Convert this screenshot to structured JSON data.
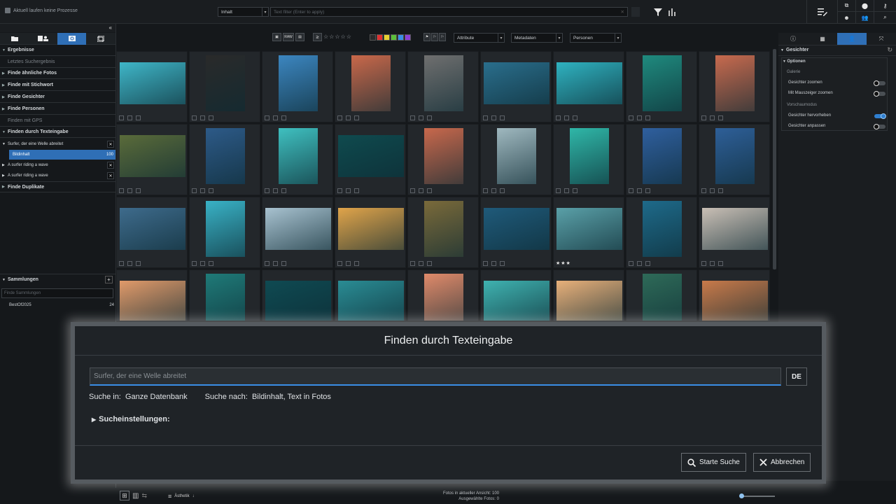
{
  "topbar": {
    "process_status": "Aktuell laufen keine Prozesse",
    "filter_scope": "Inhalt",
    "text_filter_placeholder": "Text filter (Enter to apply)",
    "right_icons": [
      "edit-list-icon",
      "copy-icon",
      "map-pin-icon",
      "key-icon",
      "face-icon",
      "people-icon",
      "search-icon"
    ]
  },
  "left_panel": {
    "tabs": [
      "folder-icon",
      "calendar-people-icon",
      "search-icon",
      "album-icon"
    ],
    "active_tab": 2,
    "sections": [
      {
        "label": "Ergebnisse",
        "dim": false
      },
      {
        "label": "Letztes Suchergebnis",
        "dim": true
      },
      {
        "label": "Finde ähnliche Fotos",
        "dim": false
      },
      {
        "label": "Finde mit Stichwort",
        "dim": false
      },
      {
        "label": "Finde Gesichter",
        "dim": false
      },
      {
        "label": "Finde Personen",
        "dim": false
      },
      {
        "label": "Finden mit GPS",
        "dim": true
      },
      {
        "label": "Finden durch Texteingabe",
        "dim": false
      }
    ],
    "text_searches": [
      {
        "label": "Surfer, der eine Welle abreitet"
      },
      {
        "label": "A surfer riding a wave"
      },
      {
        "label": "A surfer riding a wave"
      }
    ],
    "selected_sub": {
      "label": "Bildinhalt",
      "count": "100"
    },
    "duplicates": "Finde Duplikate",
    "collections": {
      "title": "Sammlungen",
      "search_placeholder": "Finde Sammlungen",
      "items": [
        {
          "name": "BestOf2025",
          "count": "24"
        }
      ]
    }
  },
  "toolbar": {
    "format_buttons": [
      "image-icon",
      "RAW",
      "film-icon"
    ],
    "ge_symbol": "≥",
    "color_swatches": [
      "#2b2b2b",
      "#e03030",
      "#e8d130",
      "#5cbf3a",
      "#3a8ee6",
      "#8a3fd6"
    ],
    "dropdowns": [
      "Attribute",
      "Metadaten",
      "Personen"
    ]
  },
  "grid": {
    "rows": [
      [
        "#3fb6c8",
        "#2a2a2a",
        "#3c86c0",
        "#c9684a",
        "#6f6f6f",
        "#2a6e8c",
        "#2fb2c0",
        "#1f8a7e",
        "#c86a4e"
      ],
      [
        "#5a6b3a",
        "#2d5a88",
        "#3fc0c0",
        "#0f4a4e",
        "#c8684c",
        "#9fb8bf",
        "#2fb7a8",
        "#2f5f9e",
        "#2e5f98"
      ],
      [
        "#3e6b8c",
        "#39b2c6",
        "#a8c2d0",
        "#e0a44a",
        "#7a6a3a",
        "#1f5a7a",
        "#5aa0a8",
        "#1e6a8a",
        "#c9bfb5"
      ],
      [
        "#e09a6a",
        "#1f7a78",
        "#0f4a52",
        "#2a8c94",
        "#e08a6a",
        "#3fb2b0",
        "#e8b07a",
        "#2e6a58",
        "#c87a4a"
      ]
    ],
    "starred": {
      "row": 2,
      "col": 6,
      "stars": "★★★"
    }
  },
  "right_panel": {
    "tabs": [
      "info-icon",
      "table-icon",
      "person-icon",
      "expand-icon"
    ],
    "active_tab": 2,
    "section": "Gesichter",
    "options_label": "Optionen",
    "galerie_label": "Galerie",
    "galerie_options": [
      {
        "label": "Gesichter zoomen",
        "on": false
      },
      {
        "label": "Mit Mauszeiger zoomen",
        "on": false
      }
    ],
    "preview_label": "Vorschaumodus",
    "preview_options": [
      {
        "label": "Gesichter hervorheben",
        "on": true
      },
      {
        "label": "Gesichter anpassen",
        "on": false
      }
    ]
  },
  "bottombar": {
    "sort_label": "Ästhetik",
    "photos_in_view_label": "Fotos in aktueller Ansicht:",
    "photos_in_view": "100",
    "selected_label": "Ausgewählte Fotos:",
    "selected": "0"
  },
  "dialog": {
    "title": "Finden durch Texteingabe",
    "query": "Surfer, der eine Welle abreitet",
    "lang": "DE",
    "search_in_label": "Suche in:",
    "search_in_value": "Ganze Datenbank",
    "search_for_label": "Suche nach:",
    "search_for_value": "Bildinhalt, Text in Fotos",
    "settings_label": "Sucheinstellungen:",
    "start_button": "Starte Suche",
    "cancel_button": "Abbrechen"
  }
}
